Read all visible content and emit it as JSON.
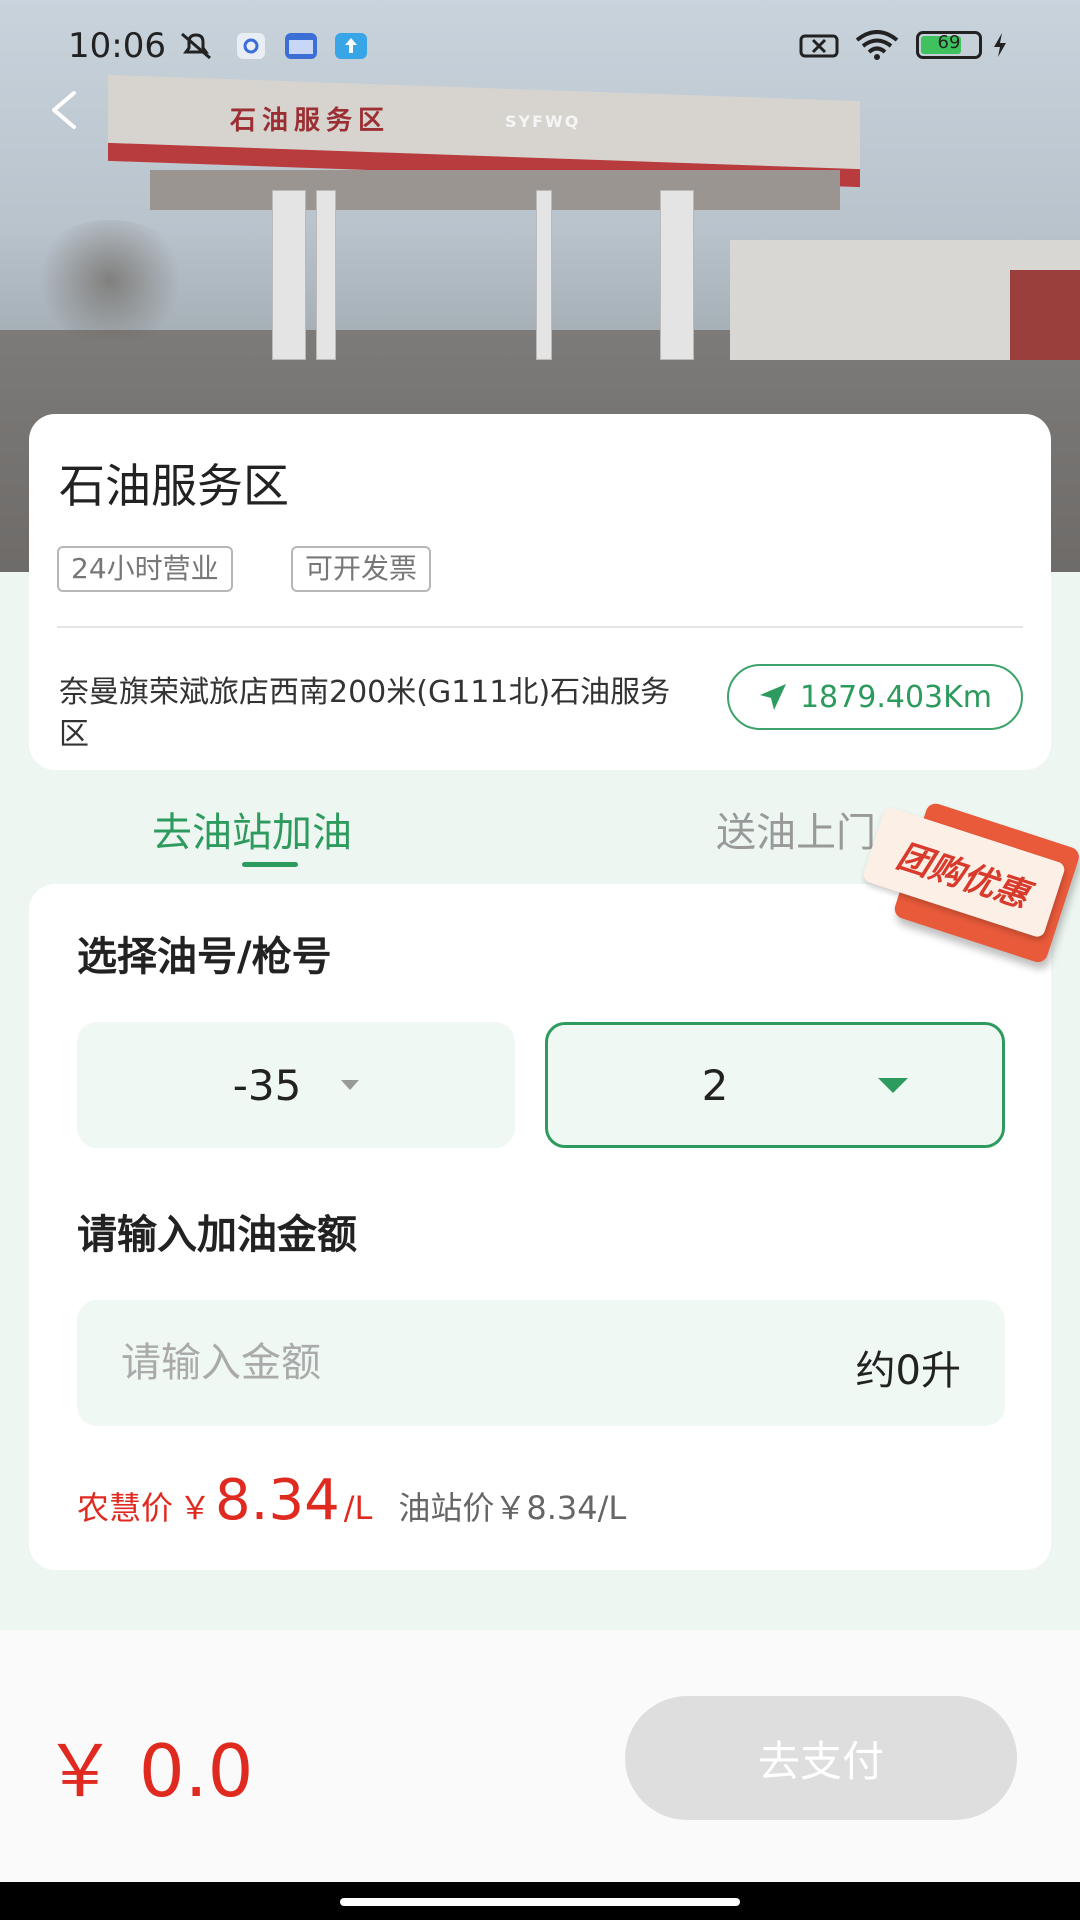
{
  "status_bar": {
    "time": "10:06",
    "battery": "69"
  },
  "hero": {
    "canopy_text": "石油服务区",
    "canopy_brand": "SYFWQ"
  },
  "station": {
    "name": "石油服务区",
    "tags": [
      "24小时营业",
      "可开发票"
    ],
    "address": "奈曼旗荣斌旅店西南200米(G111北)石油服务区",
    "distance": "1879.403Km"
  },
  "tabs": [
    {
      "label": "去油站加油",
      "active": true
    },
    {
      "label": "送油上门",
      "active": false
    }
  ],
  "promo_badge": "团购优惠",
  "fuel_section": {
    "title": "选择油号/枪号",
    "fuel_value": "-35",
    "gun_value": "2"
  },
  "amount_section": {
    "title": "请输入加油金额",
    "placeholder": "请输入金额",
    "liters": "约0升"
  },
  "price": {
    "label": "农慧价",
    "currency": "￥",
    "value": "8.34",
    "unit": "/L",
    "station_price": "油站价￥8.34/L"
  },
  "bottom": {
    "total": "￥ 0.0",
    "pay_label": "去支付"
  },
  "colors": {
    "accent": "#2e9b5e",
    "price_red": "#e02a20",
    "disabled_button": "#dedede",
    "page_bg": "#edf6f1"
  }
}
